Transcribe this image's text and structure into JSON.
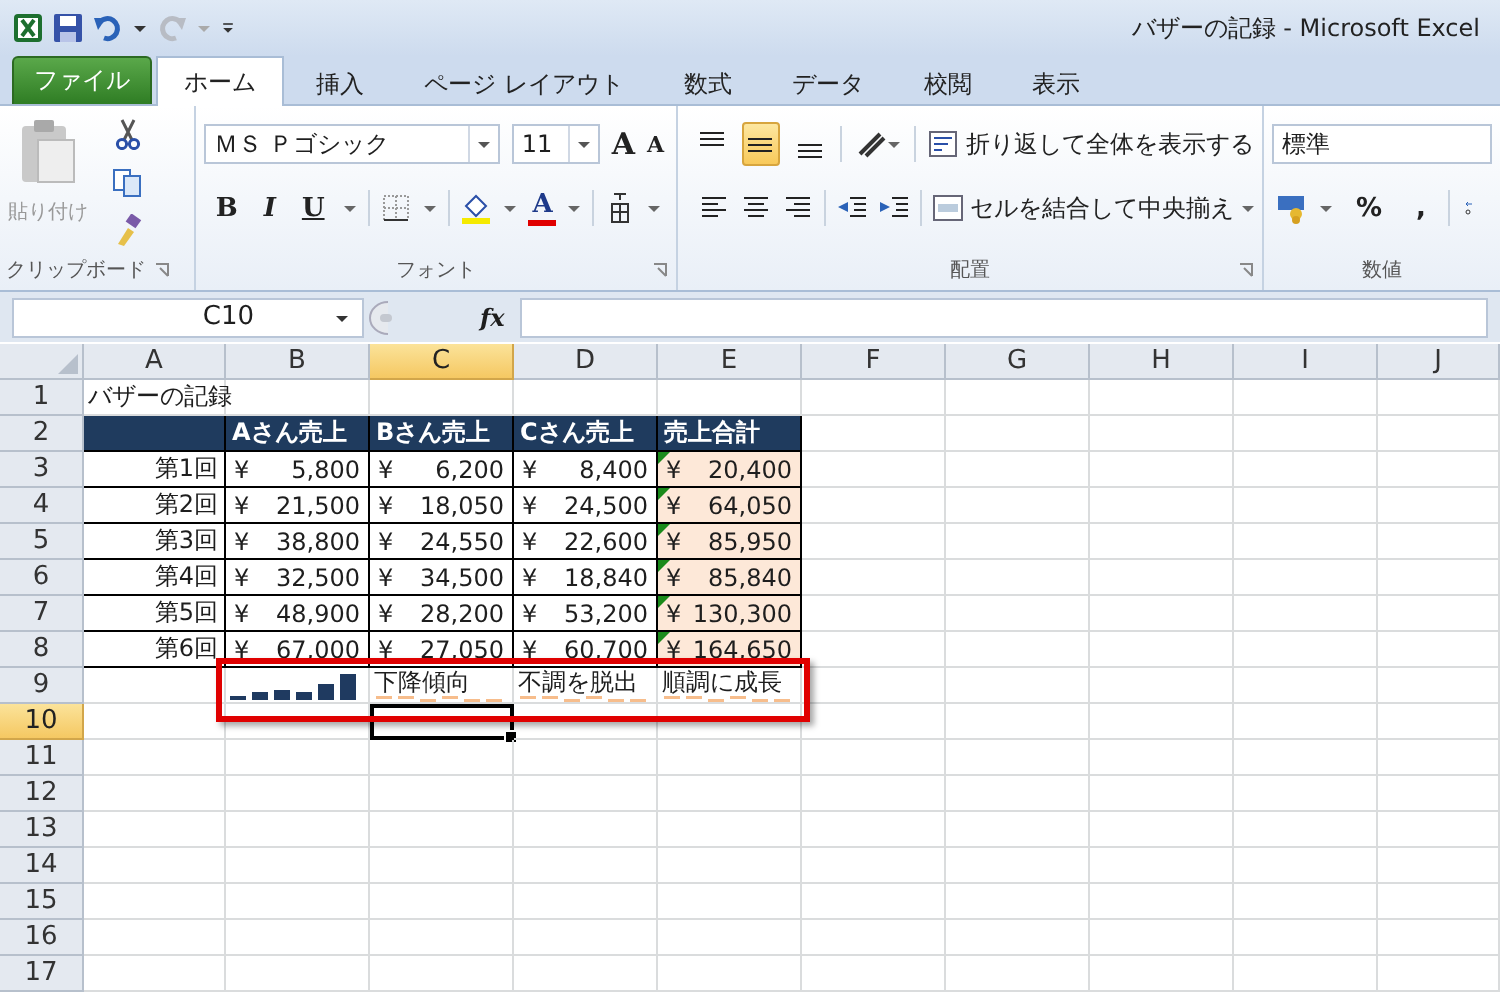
{
  "window": {
    "title": "バザーの記録 - Microsoft Excel"
  },
  "ribbon_tabs": [
    {
      "label": "ファイル",
      "kind": "file",
      "selected": false
    },
    {
      "label": "ホーム",
      "kind": "tab",
      "selected": true
    },
    {
      "label": "挿入",
      "kind": "tab",
      "selected": false
    },
    {
      "label": "ページ レイアウト",
      "kind": "tab",
      "selected": false
    },
    {
      "label": "数式",
      "kind": "tab",
      "selected": false
    },
    {
      "label": "データ",
      "kind": "tab",
      "selected": false
    },
    {
      "label": "校閲",
      "kind": "tab",
      "selected": false
    },
    {
      "label": "表示",
      "kind": "tab",
      "selected": false
    }
  ],
  "clipboard": {
    "label": "クリップボード",
    "paste_label": "貼り付け"
  },
  "font": {
    "label": "フォント",
    "font_name": "ＭＳ Ｐゴシック",
    "font_size": "11",
    "grow_glyph": "A",
    "shrink_glyph": "A",
    "style_buttons": [
      "B",
      "I",
      "U"
    ],
    "font_color_glyph": "A"
  },
  "alignment": {
    "label": "配置",
    "vertical_align": [
      {
        "selected": false
      },
      {
        "selected": true
      },
      {
        "selected": false
      }
    ],
    "wrap_text": "折り返して全体を表示する",
    "merge_center": "セルを結合して中央揃え"
  },
  "number": {
    "label": "数値",
    "format": "標準",
    "percent": "%",
    "comma": ","
  },
  "formula_bar": {
    "name_box": "C10",
    "fx": "fx"
  },
  "sheet": {
    "highlight_frame": true,
    "columns": [
      {
        "label": "A",
        "selected": false
      },
      {
        "label": "B",
        "selected": false
      },
      {
        "label": "C",
        "selected": true
      },
      {
        "label": "D",
        "selected": false
      },
      {
        "label": "E",
        "selected": false
      },
      {
        "label": "F",
        "selected": false
      },
      {
        "label": "G",
        "selected": false
      },
      {
        "label": "H",
        "selected": false
      },
      {
        "label": "I",
        "selected": false
      },
      {
        "label": "J",
        "selected": false
      }
    ],
    "rows": [
      {
        "label": "1",
        "selected": false,
        "cells": [
          {
            "kind": "text",
            "text": "バザーの記録"
          }
        ]
      },
      {
        "label": "2",
        "selected": false,
        "cells": [
          {
            "kind": "header"
          },
          {
            "kind": "header",
            "text": "Aさん売上"
          },
          {
            "kind": "header",
            "text": "Bさん売上"
          },
          {
            "kind": "header",
            "text": "Cさん売上"
          },
          {
            "kind": "header",
            "text": "売上合計"
          }
        ]
      },
      {
        "label": "3",
        "selected": false,
        "cells": [
          {
            "kind": "label",
            "text": "第1回"
          },
          {
            "kind": "currency",
            "symbol": "¥",
            "value": "5,800"
          },
          {
            "kind": "currency",
            "symbol": "¥",
            "value": "6,200"
          },
          {
            "kind": "currency",
            "symbol": "¥",
            "value": "8,400"
          },
          {
            "kind": "total",
            "symbol": "¥",
            "value": "20,400"
          }
        ]
      },
      {
        "label": "4",
        "selected": false,
        "cells": [
          {
            "kind": "label",
            "text": "第2回"
          },
          {
            "kind": "currency",
            "symbol": "¥",
            "value": "21,500"
          },
          {
            "kind": "currency",
            "symbol": "¥",
            "value": "18,050"
          },
          {
            "kind": "currency",
            "symbol": "¥",
            "value": "24,500"
          },
          {
            "kind": "total",
            "symbol": "¥",
            "value": "64,050"
          }
        ]
      },
      {
        "label": "5",
        "selected": false,
        "cells": [
          {
            "kind": "label",
            "text": "第3回"
          },
          {
            "kind": "currency",
            "symbol": "¥",
            "value": "38,800"
          },
          {
            "kind": "currency",
            "symbol": "¥",
            "value": "24,550"
          },
          {
            "kind": "currency",
            "symbol": "¥",
            "value": "22,600"
          },
          {
            "kind": "total",
            "symbol": "¥",
            "value": "85,950"
          }
        ]
      },
      {
        "label": "6",
        "selected": false,
        "cells": [
          {
            "kind": "label",
            "text": "第4回"
          },
          {
            "kind": "currency",
            "symbol": "¥",
            "value": "32,500"
          },
          {
            "kind": "currency",
            "symbol": "¥",
            "value": "34,500"
          },
          {
            "kind": "currency",
            "symbol": "¥",
            "value": "18,840"
          },
          {
            "kind": "total",
            "symbol": "¥",
            "value": "85,840"
          }
        ]
      },
      {
        "label": "7",
        "selected": false,
        "cells": [
          {
            "kind": "label",
            "text": "第5回"
          },
          {
            "kind": "currency",
            "symbol": "¥",
            "value": "48,900"
          },
          {
            "kind": "currency",
            "symbol": "¥",
            "value": "28,200"
          },
          {
            "kind": "currency",
            "symbol": "¥",
            "value": "53,200"
          },
          {
            "kind": "total",
            "symbol": "¥",
            "value": "130,300"
          }
        ]
      },
      {
        "label": "8",
        "selected": false,
        "cells": [
          {
            "kind": "label",
            "text": "第6回"
          },
          {
            "kind": "currency",
            "symbol": "¥",
            "value": "67,000"
          },
          {
            "kind": "currency",
            "symbol": "¥",
            "value": "27,050"
          },
          {
            "kind": "currency",
            "symbol": "¥",
            "value": "60,700"
          },
          {
            "kind": "total",
            "symbol": "¥",
            "value": "164,650"
          }
        ]
      },
      {
        "label": "9",
        "selected": false,
        "cells": [
          {
            "kind": "empty"
          },
          {
            "kind": "sparkline_column"
          },
          {
            "kind": "sparkline_text",
            "text": "下降傾向"
          },
          {
            "kind": "sparkline_text",
            "text": "不調を脱出"
          },
          {
            "kind": "sparkline_text",
            "text": "順調に成長"
          }
        ]
      },
      {
        "label": "10",
        "selected": true
      },
      {
        "label": "11",
        "selected": false
      },
      {
        "label": "12",
        "selected": false
      },
      {
        "label": "13",
        "selected": false
      },
      {
        "label": "14",
        "selected": false
      },
      {
        "label": "15",
        "selected": false
      },
      {
        "label": "16",
        "selected": false
      },
      {
        "label": "17",
        "selected": false
      }
    ]
  }
}
